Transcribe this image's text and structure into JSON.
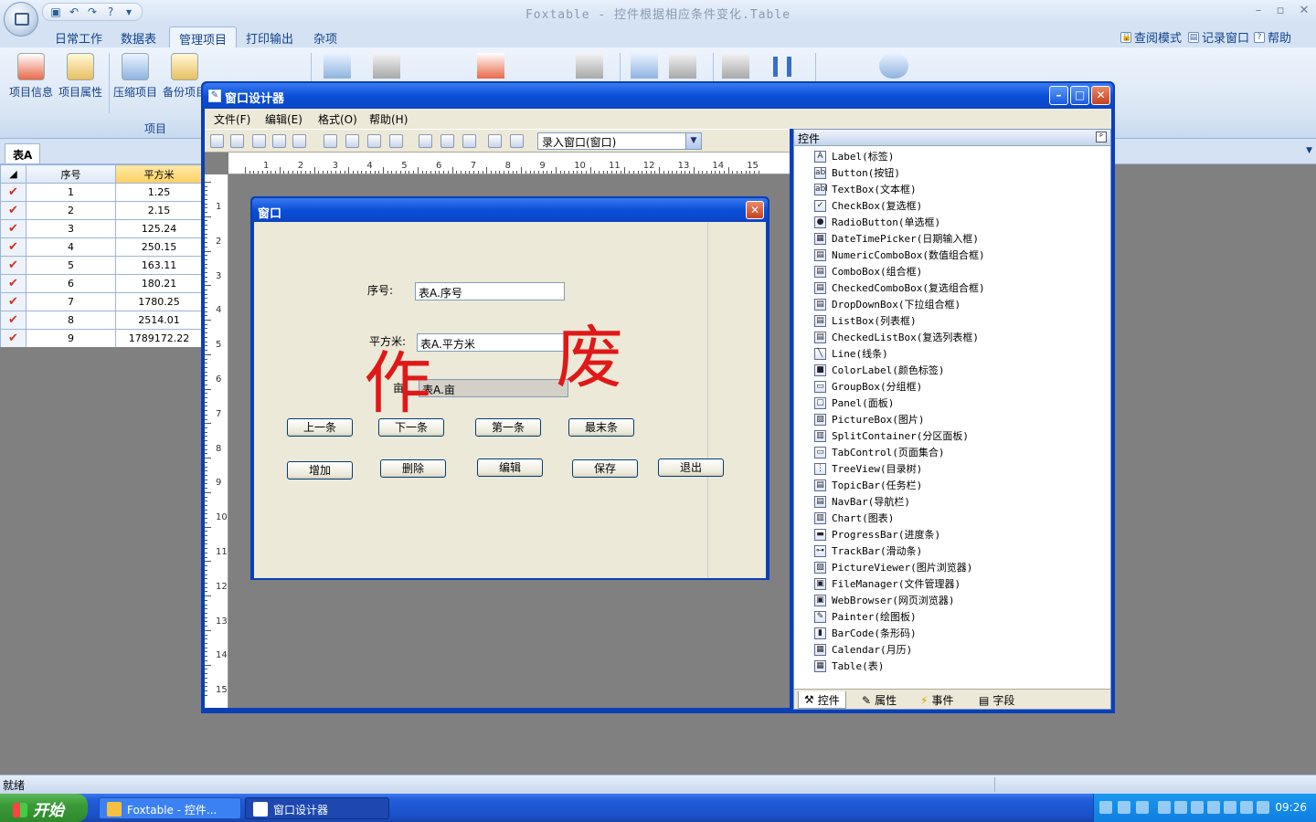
{
  "app": {
    "title": "Foxtable - 控件根据相应条件变化.Table"
  },
  "ribbon": {
    "tabs": [
      "日常工作",
      "数据表",
      "管理项目",
      "打印输出",
      "杂项"
    ],
    "active_tab": "管理项目",
    "right_links": [
      "查阅模式",
      "记录窗口",
      "帮助"
    ],
    "buttons": [
      "项目信息",
      "项目属性",
      "压缩项目",
      "备份项目"
    ],
    "group_label": "项目"
  },
  "sheet": {
    "tab": "表A",
    "columns": [
      "序号",
      "平方米"
    ],
    "check_mark": "✔",
    "rows": [
      {
        "seq": "1",
        "area": "1.25"
      },
      {
        "seq": "2",
        "area": "2.15"
      },
      {
        "seq": "3",
        "area": "125.24"
      },
      {
        "seq": "4",
        "area": "250.15"
      },
      {
        "seq": "5",
        "area": "163.11"
      },
      {
        "seq": "6",
        "area": "180.21"
      },
      {
        "seq": "7",
        "area": "1780.25"
      },
      {
        "seq": "8",
        "area": "2514.01"
      },
      {
        "seq": "9",
        "area": "1789172.22"
      }
    ]
  },
  "designer": {
    "title": "窗口设计器",
    "menu": [
      "文件(F)",
      "编辑(E)",
      "格式(O)",
      "帮助(H)"
    ],
    "combo_value": "录入窗口(窗口)",
    "ruler_h": [
      "1",
      "2",
      "3",
      "4",
      "5",
      "6",
      "7",
      "8",
      "9",
      "10",
      "11",
      "12",
      "13",
      "14",
      "15"
    ],
    "ruler_v": [
      "1",
      "2",
      "3",
      "4",
      "5",
      "6",
      "7",
      "8",
      "9",
      "10",
      "11",
      "12",
      "13",
      "14",
      "15"
    ]
  },
  "form": {
    "title": "窗口",
    "label_seq": "序号:",
    "input_seq": "表A.序号",
    "label_area": "平方米:",
    "input_area": "表A.平方米",
    "label_mu": "亩",
    "input_mu": "表A.亩",
    "stamp_left": "作",
    "stamp_right": "废",
    "buttons_row1": [
      "上一条",
      "下一条",
      "第一条",
      "最末条"
    ],
    "buttons_row2": [
      "增加",
      "删除",
      "编辑",
      "保存",
      "退出"
    ]
  },
  "controls": {
    "header": "控件",
    "items": [
      "Label(标签)",
      "Button(按钮)",
      "TextBox(文本框)",
      "CheckBox(复选框)",
      "RadioButton(单选框)",
      "DateTimePicker(日期输入框)",
      "NumericComboBox(数值组合框)",
      "ComboBox(组合框)",
      "CheckedComboBox(复选组合框)",
      "DropDownBox(下拉组合框)",
      "ListBox(列表框)",
      "CheckedListBox(复选列表框)",
      "Line(线条)",
      "ColorLabel(颜色标签)",
      "GroupBox(分组框)",
      "Panel(面板)",
      "PictureBox(图片)",
      "SplitContainer(分区面板)",
      "TabControl(页面集合)",
      "TreeView(目录树)",
      "TopicBar(任务栏)",
      "NavBar(导航栏)",
      "Chart(图表)",
      "ProgressBar(进度条)",
      "TrackBar(滑动条)",
      "PictureViewer(图片浏览器)",
      "FileManager(文件管理器)",
      "WebBrowser(网页浏览器)",
      "Painter(绘图板)",
      "BarCode(条形码)",
      "Calendar(月历)",
      "Table(表)"
    ],
    "icon_glyphs": [
      "A",
      "ab",
      "abl",
      "✓",
      "●",
      "▦",
      "▤",
      "▤",
      "▤",
      "▤",
      "▤",
      "▤",
      "╲",
      "■",
      "▭",
      "▢",
      "▨",
      "▥",
      "▭",
      "⋮",
      "▤",
      "▤",
      "▥",
      "▬",
      "⊶",
      "▨",
      "▣",
      "▣",
      "✎",
      "▮",
      "▦",
      "▦"
    ],
    "tabs": [
      "控件",
      "属性",
      "事件",
      "字段"
    ]
  },
  "status": {
    "text": "就绪"
  },
  "taskbar": {
    "start": "开始",
    "tasks": [
      "Foxtable - 控件...",
      "窗口设计器"
    ],
    "clock": "09:26"
  },
  "colors": {
    "xp_blue": "#0a3fb8",
    "stamp_red": "#e01818",
    "ribbon_blue": "#15428b"
  }
}
